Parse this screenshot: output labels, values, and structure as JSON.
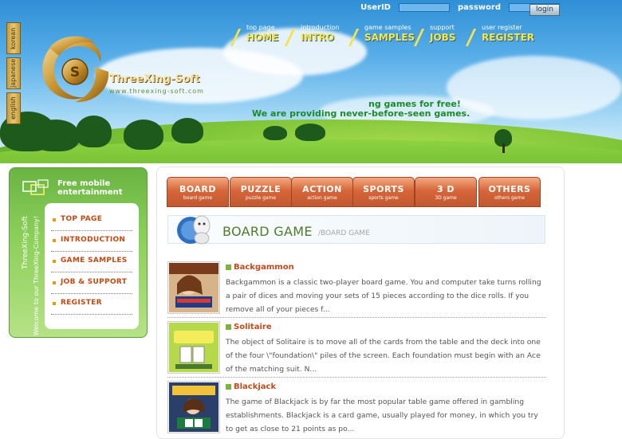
{
  "header": {
    "lang_tabs": [
      "korean",
      "japanese",
      "english"
    ],
    "logo_name": "ThreeXing-Soft",
    "logo_url": "www.threexing-soft.com",
    "login": {
      "userid_label": "UserID",
      "password_label": "password",
      "button_label": "login"
    },
    "nav": [
      {
        "small": "top page",
        "big": "HOME"
      },
      {
        "small": "introduction",
        "big": "INTRO"
      },
      {
        "small": "game samples",
        "big": "SAMPLES"
      },
      {
        "small": "support",
        "big": "JOBS"
      },
      {
        "small": "user register",
        "big": "REGISTER"
      }
    ],
    "slogan_line1": "ng games for free!",
    "slogan_line2": "We are providing never-before-seen games."
  },
  "sidebar": {
    "title_line1": "Free mobile",
    "title_line2": "entertainment",
    "vertical_text_1": "ThreeXing-Soft",
    "vertical_text_2": "Welcome to our ThreeXing-Company!",
    "menu": [
      "TOP PAGE",
      "INTRODUCTION",
      "GAME SAMPLES",
      "JOB & SUPPORT",
      "REGISTER"
    ]
  },
  "main": {
    "tabs": [
      {
        "label": "BOARD",
        "sub": "board game"
      },
      {
        "label": "PUZZLE",
        "sub": "puzzle game"
      },
      {
        "label": "ACTION",
        "sub": "action game"
      },
      {
        "label": "SPORTS",
        "sub": "sports game"
      },
      {
        "label": "3 D",
        "sub": "3D game"
      },
      {
        "label": "OTHERS",
        "sub": "others game"
      }
    ],
    "section_title": "BOARD GAME",
    "section_sub": "/BOARD GAME",
    "games": [
      {
        "name": "Backgammon",
        "desc": "Backgammon is a classic two-player board game. You and computer take turns rolling a pair of dices and moving your sets of 15 pieces according to the dice rolls. If you remove all of your pieces f..."
      },
      {
        "name": "Solitaire",
        "desc": "The object of Solitaire is to move all of the cards from the table and the deck into one of the four \\\"foundation\\\" piles of the screen. Each foundation must begin with an Ace of the matching suit. N..."
      },
      {
        "name": "Blackjack",
        "desc": "The game of Blackjack is by far the most popular table game offered in gambling establishments. Blackjack is a card game, usually played for money, in which you try to get as close to 21 points as po..."
      }
    ]
  }
}
